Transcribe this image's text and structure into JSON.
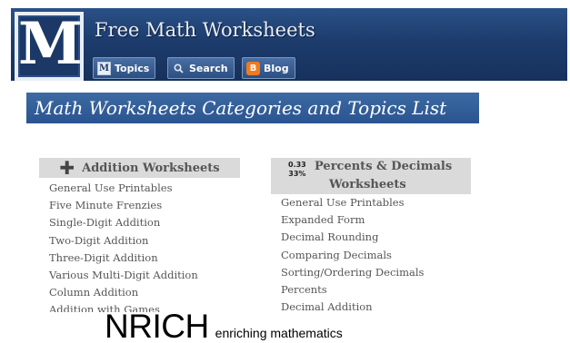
{
  "header": {
    "logo_letter": "M",
    "site_title": "Free Math Worksheets",
    "nav": [
      {
        "icon": "m-logo-icon",
        "icon_text": "M",
        "label": "Topics"
      },
      {
        "icon": "search-icon",
        "label": "Search"
      },
      {
        "icon": "blogger-icon",
        "icon_text": "B",
        "label": "Blog"
      }
    ]
  },
  "section": {
    "title": "Math Worksheets Categories and Topics List"
  },
  "addition": {
    "icon": "plus-icon",
    "title": "Addition Worksheets",
    "items": [
      "General Use Printables",
      "Five Minute Frenzies",
      "Single-Digit Addition",
      "Two-Digit Addition",
      "Three-Digit Addition",
      "Various Multi-Digit Addition",
      "Column Addition",
      "Addition with Games"
    ]
  },
  "percents": {
    "icon_top": "0.33",
    "icon_bottom": "33%",
    "title_line1": "Percents & Decimals",
    "title_line2": "Worksheets",
    "items": [
      "General Use Printables",
      "Expanded Form",
      "Decimal Rounding",
      "Comparing Decimals",
      "Sorting/Ordering Decimals",
      "Percents",
      "Decimal Addition"
    ]
  },
  "footer_logo": {
    "name": "NRICH",
    "tagline": "enriching mathematics"
  }
}
